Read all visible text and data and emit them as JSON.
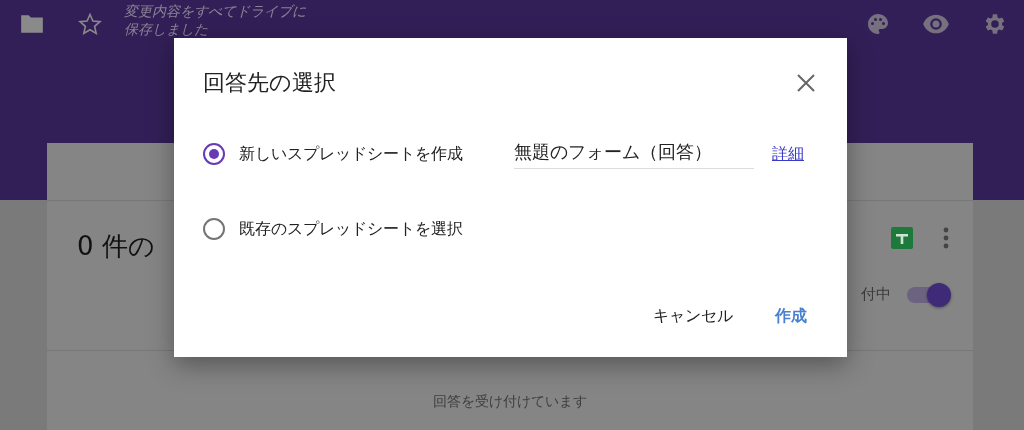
{
  "toolbar": {
    "save_status": "変更内容をすべてドライブに保存しました"
  },
  "responses_card": {
    "heading": "0 件の",
    "accepting_label": "付中",
    "accepting": {
      "on": true
    },
    "message": "回答を受け付けています"
  },
  "dialog": {
    "title": "回答先の選択",
    "options": [
      {
        "label": "新しいスプレッドシートを作成",
        "selected": true
      },
      {
        "label": "既存のスプレッドシートを選択",
        "selected": false
      }
    ],
    "sheet_name": {
      "value": "無題のフォーム（回答）"
    },
    "details_link": "詳細",
    "buttons": [
      {
        "label": "キャンセル",
        "kind": "plain"
      },
      {
        "label": "作成",
        "kind": "primary"
      }
    ]
  }
}
